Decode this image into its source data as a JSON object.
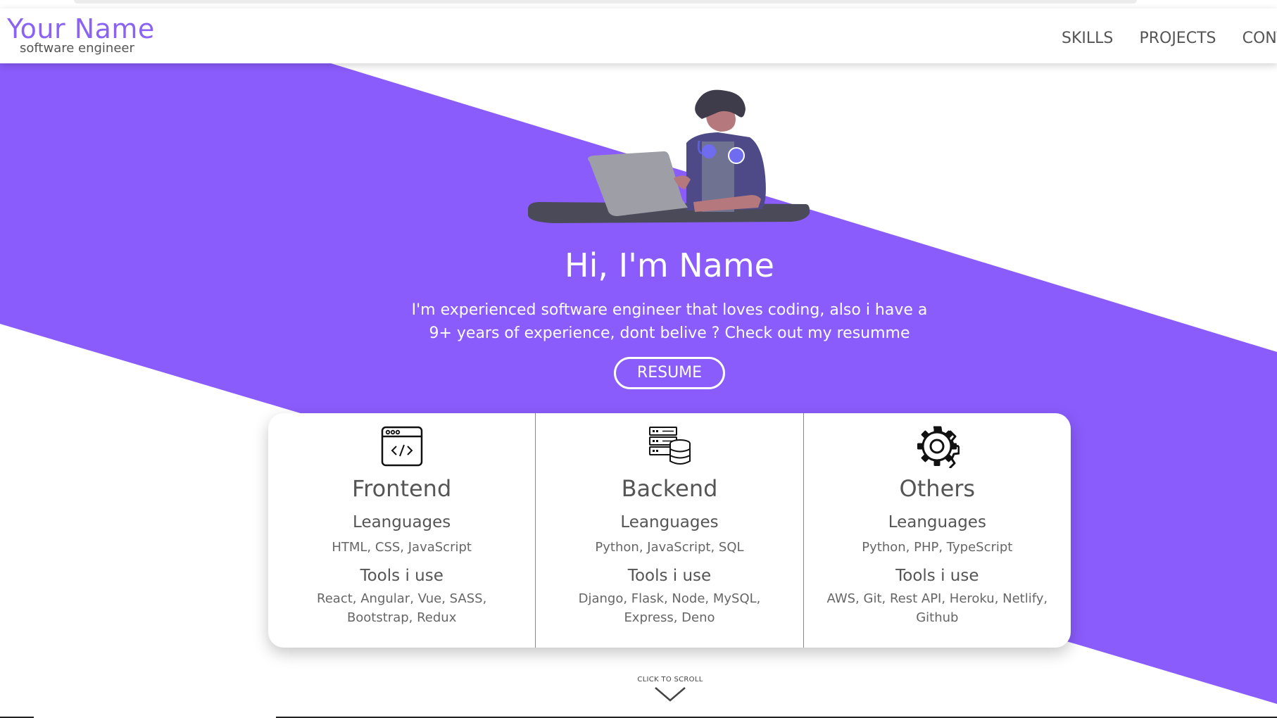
{
  "brand": {
    "name": "Your Name",
    "subtitle": "software engineer"
  },
  "nav": {
    "items": [
      "SKILLS",
      "PROJECTS",
      "CONTACT"
    ]
  },
  "hero": {
    "title": "Hi, I'm Name",
    "text_line1": "I'm experienced software engineer that loves coding, also i have a",
    "text_line2": "9+ years of experience, dont belive ? Check out my resumme",
    "button": "RESUME"
  },
  "skills": [
    {
      "icon": "code-window-icon",
      "title": "Frontend",
      "languages_label": "Leanguages",
      "languages": "HTML, CSS, JavaScript",
      "tools_label": "Tools i use",
      "tools": "React, Angular, Vue, SASS, Bootstrap, Redux"
    },
    {
      "icon": "database-server-icon",
      "title": "Backend",
      "languages_label": "Leanguages",
      "languages": "Python, JavaScript, SQL",
      "tools_label": "Tools i use",
      "tools": "Django, Flask, Node, MySQL, Express, Deno"
    },
    {
      "icon": "gear-icon",
      "title": "Others",
      "languages_label": "Leanguages",
      "languages": "Python, PHP, TypeScript",
      "tools_label": "Tools i use",
      "tools": "AWS, Git, Rest API, Heroku, Netlify, Github"
    }
  ],
  "scroll_hint": "CLICK TO SCROLL",
  "colors": {
    "accent": "#8a5cfc",
    "brand": "#8a63f5",
    "text": "#555555",
    "background": "#ffffff"
  }
}
